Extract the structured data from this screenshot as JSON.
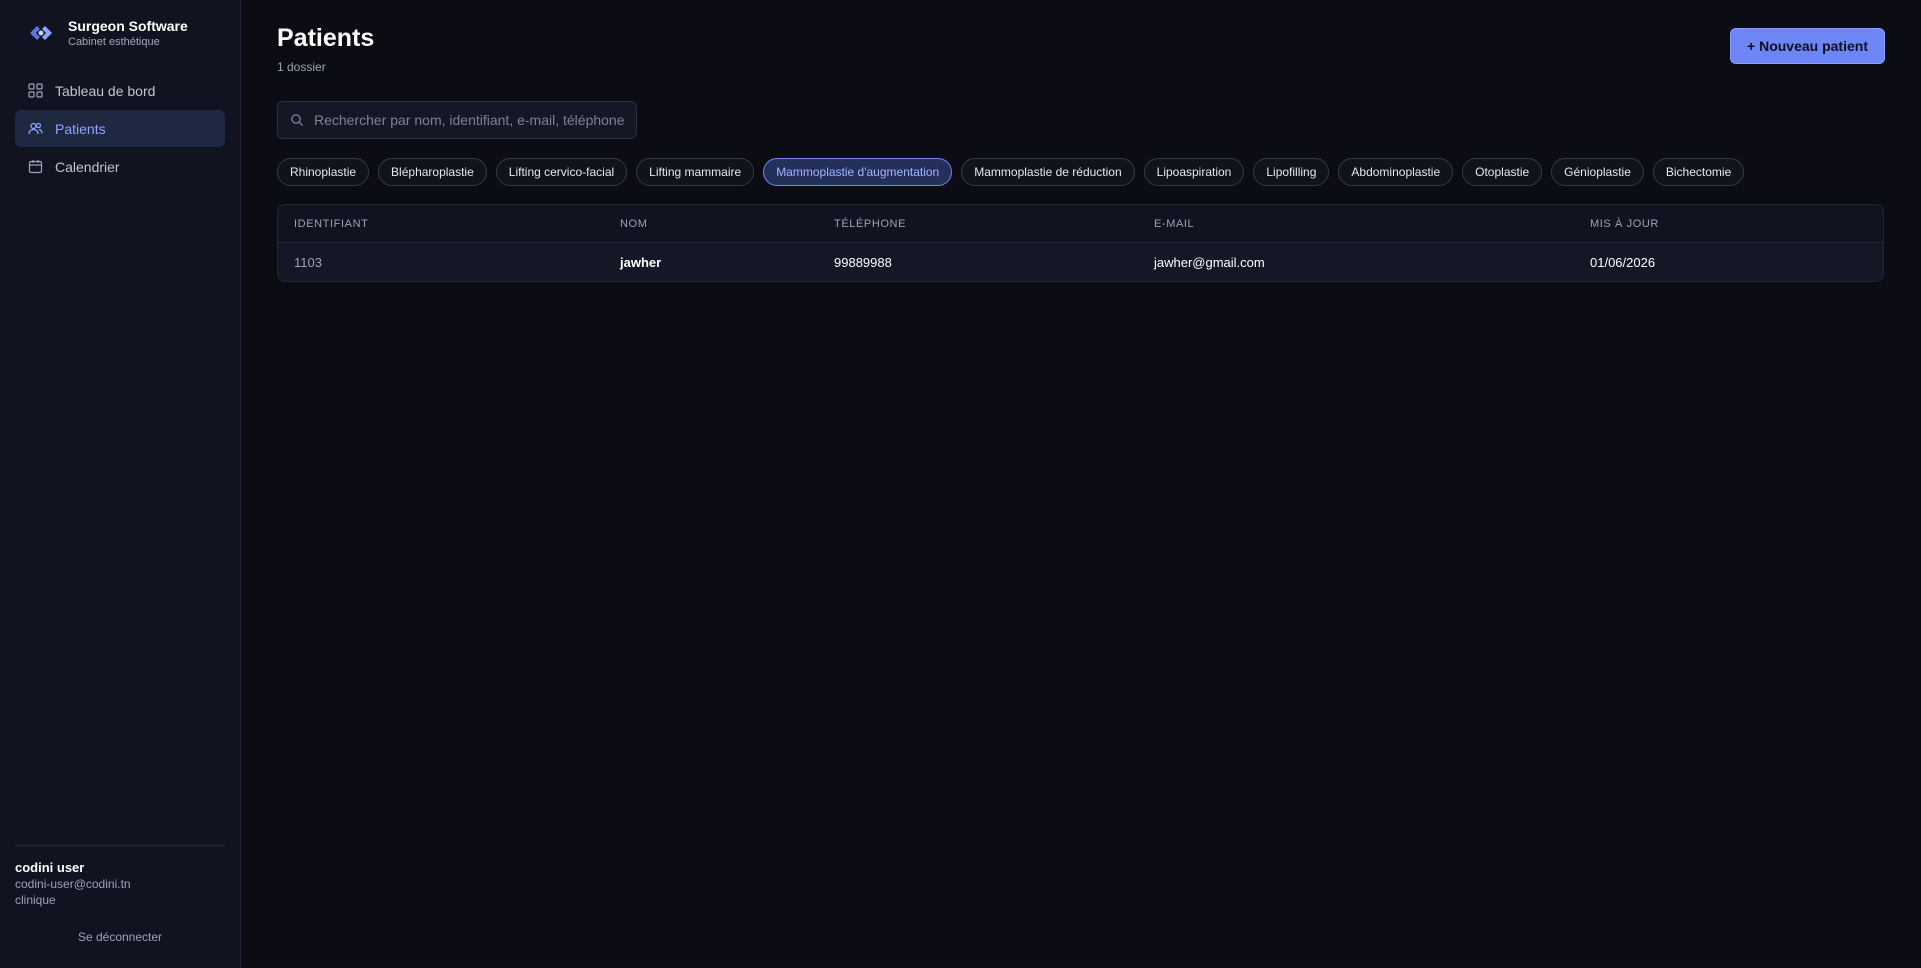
{
  "brand": {
    "name": "Surgeon Software",
    "subtitle": "Cabinet esthétique"
  },
  "nav": [
    {
      "label": "Tableau de bord",
      "icon": "dashboard-icon",
      "active": false
    },
    {
      "label": "Patients",
      "icon": "users-icon",
      "active": true
    },
    {
      "label": "Calendrier",
      "icon": "calendar-icon",
      "active": false
    }
  ],
  "user": {
    "name": "codini user",
    "email": "codini-user@codini.tn",
    "role": "clinique",
    "logout_label": "Se déconnecter"
  },
  "page": {
    "title": "Patients",
    "count": "1 dossier",
    "new_button": "+ Nouveau patient"
  },
  "search": {
    "placeholder": "Rechercher par nom, identifiant, e-mail, téléphone",
    "value": ""
  },
  "filters": [
    {
      "label": "Rhinoplastie",
      "active": false
    },
    {
      "label": "Blépharoplastie",
      "active": false
    },
    {
      "label": "Lifting cervico-facial",
      "active": false
    },
    {
      "label": "Lifting mammaire",
      "active": false
    },
    {
      "label": "Mammoplastie d'augmentation",
      "active": true
    },
    {
      "label": "Mammoplastie de réduction",
      "active": false
    },
    {
      "label": "Lipoaspiration",
      "active": false
    },
    {
      "label": "Lipofilling",
      "active": false
    },
    {
      "label": "Abdominoplastie",
      "active": false
    },
    {
      "label": "Otoplastie",
      "active": false
    },
    {
      "label": "Génioplastie",
      "active": false
    },
    {
      "label": "Bichectomie",
      "active": false
    }
  ],
  "table": {
    "columns": [
      "IDENTIFIANT",
      "NOM",
      "TÉLÉPHONE",
      "E-MAIL",
      "MIS À JOUR"
    ],
    "rows": [
      [
        "1103",
        "jawher",
        "99889988",
        "jawher@gmail.com",
        "01/06/2026"
      ]
    ]
  },
  "colors": {
    "accent": "#6e86f5",
    "background": "#0c0d14",
    "sidebar": "#111320",
    "active_nav": "#1f2841"
  }
}
